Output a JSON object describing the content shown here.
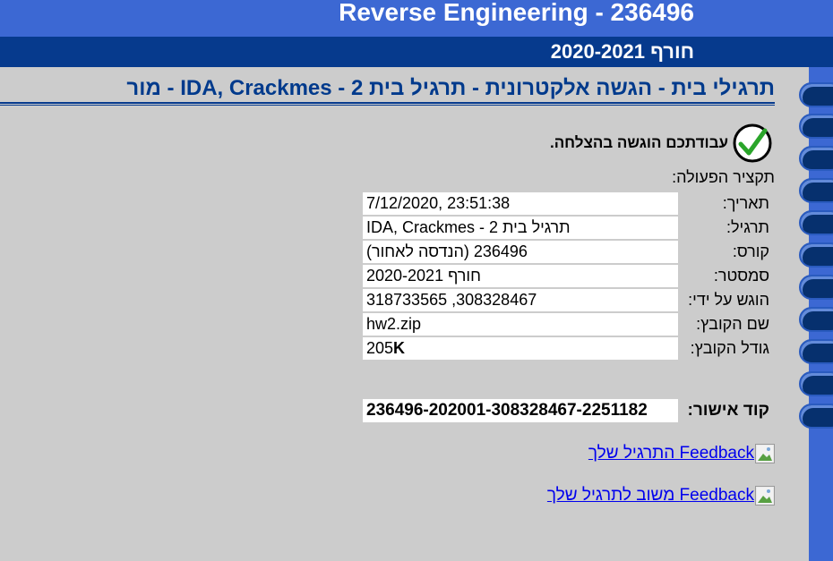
{
  "header": {
    "course_title": "Reverse Engineering - 236496",
    "semester": "חורף 2020-2021"
  },
  "page_heading": "תרגילי בית - הגשה אלקטרונית - תרגיל בית 2 - IDA, Crackmes - מור",
  "status": {
    "icon": "check-icon",
    "message": "עבודתכם הוגשה בהצלחה."
  },
  "summary_label": "תקציר הפעולה:",
  "details": [
    {
      "label": "תאריך:",
      "value": "7/12/2020, 23:51:38"
    },
    {
      "label": "תרגיל:",
      "value": "תרגיל בית 2 - IDA, Crackmes"
    },
    {
      "label": "קורס:",
      "value": "236496 (הנדסה לאחור)"
    },
    {
      "label": "סמסטר:",
      "value": "חורף 2020-2021"
    },
    {
      "label": "הוגש על ידי:",
      "value": "308328467, 318733565"
    },
    {
      "label": "שם הקובץ:",
      "value": "hw2.zip"
    },
    {
      "label": "גודל הקובץ:",
      "value": "205",
      "unit": "K"
    }
  ],
  "approval": {
    "label": "קוד אישור:",
    "code": "236496-202001-308328467-2251182"
  },
  "links": [
    {
      "text": "Feedback התרגיל שלך",
      "icon": "broken-image-icon"
    },
    {
      "text": "Feedback משוב לתרגיל שלך",
      "icon": "broken-image-icon"
    }
  ],
  "colors": {
    "header_blue": "#3c68d3",
    "semester_bar": "#063a8d",
    "heading_text": "#003a8c",
    "background": "#cccccc",
    "link": "#0000ee"
  }
}
